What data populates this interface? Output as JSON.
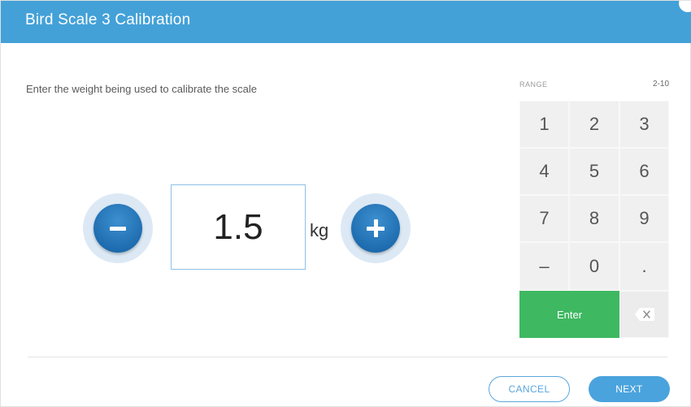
{
  "dialog": {
    "title": "Bird Scale 3 Calibration"
  },
  "instruction": "Enter the weight being used to calibrate the scale",
  "weight": {
    "value": "1.5",
    "unit": "kg"
  },
  "range": {
    "label": "RANGE",
    "value": "2-10"
  },
  "keypad": {
    "keys": [
      "1",
      "2",
      "3",
      "4",
      "5",
      "6",
      "7",
      "8",
      "9",
      "–",
      "0",
      "."
    ],
    "enter_label": "Enter",
    "backspace_icon": "backspace-icon"
  },
  "footer": {
    "cancel_label": "CANCEL",
    "next_label": "NEXT"
  },
  "colors": {
    "header": "#43a1d8",
    "stepper": "#1e6db0",
    "enter": "#3fb862",
    "primary_button": "#4aa3dd"
  }
}
